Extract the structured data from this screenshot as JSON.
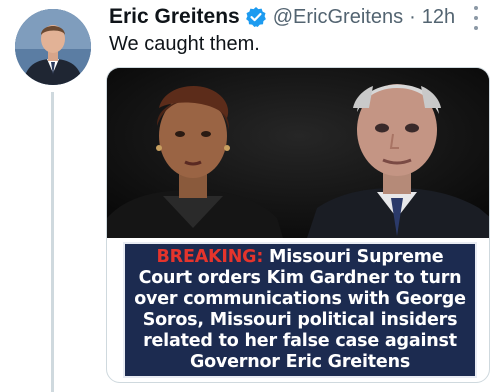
{
  "author": {
    "display_name": "Eric Greitens",
    "handle": "@EricGreitens",
    "separator": "·",
    "timestamp": "12h",
    "verified": true
  },
  "tweet": {
    "text": "We caught them."
  },
  "media": {
    "caption_prefix": "BREAKING:",
    "caption_body": " Missouri Supreme Court orders Kim Gardner to turn over communications with George Soros, Missouri political insiders related to her false case against Governor Eric Greitens"
  },
  "icons": {
    "verified": "verified-badge-icon",
    "more": "more-options-icon"
  },
  "colors": {
    "verified_blue": "#1d9bf0",
    "breaking_red": "#e5342c",
    "caption_bg": "#1c2b50",
    "text_secondary": "#536471"
  }
}
